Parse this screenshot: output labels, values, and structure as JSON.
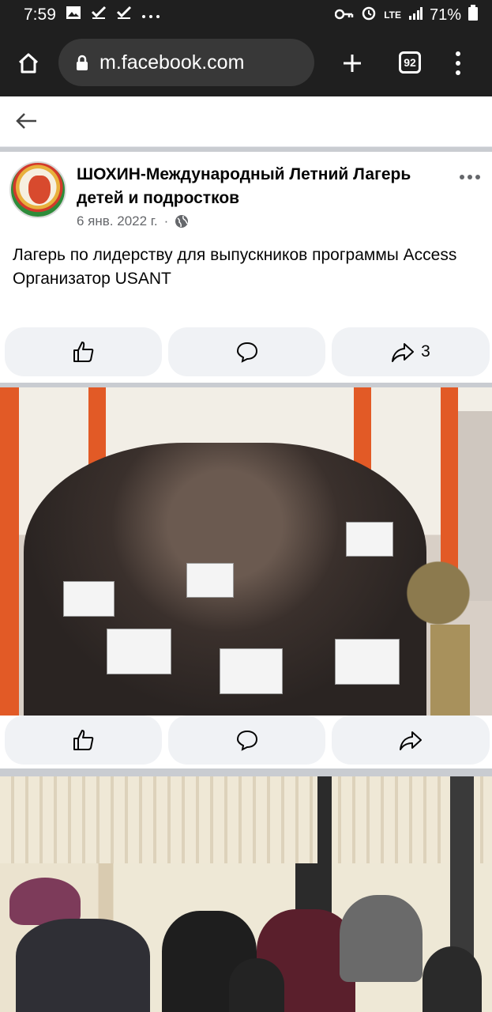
{
  "status_bar": {
    "time": "7:59",
    "left_icons": [
      "gallery-icon",
      "check-icon",
      "check-icon",
      "more-dots-icon"
    ],
    "battery": "71%",
    "network": "LTE"
  },
  "browser": {
    "url": "m.facebook.com",
    "tab_count": "92"
  },
  "post": {
    "page_name": "ШОХИН-Международный Летний Лагерь детей и подростков",
    "date": "6 янв. 2022 г.",
    "separator": "·",
    "text_line1": "Лагерь по лидерству  для выпускников программы Access",
    "text_line2": "Организатор USANT",
    "share_count": "3"
  },
  "colors": {
    "status_bg": "#1f1f1f",
    "url_pill": "#383838",
    "action_bg": "#f0f2f5",
    "divider": "#c9ccd1",
    "meta_text": "#65676b"
  }
}
